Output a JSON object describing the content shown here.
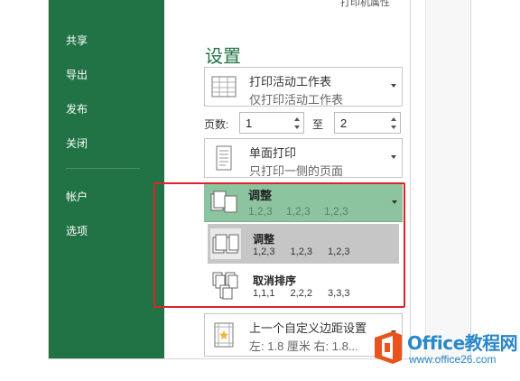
{
  "sidebar": {
    "items": [
      {
        "label": "共享"
      },
      {
        "label": "导出"
      },
      {
        "label": "发布"
      },
      {
        "label": "关闭"
      },
      {
        "label": "帐户"
      },
      {
        "label": "选项"
      }
    ]
  },
  "main": {
    "top_link": "打印机属性",
    "title": "设置",
    "print_what": {
      "title": "打印活动工作表",
      "subtitle": "仅打印活动工作表"
    },
    "pages": {
      "label": "页数:",
      "from_value": "1",
      "to_label": "至",
      "to_value": "2"
    },
    "sides": {
      "title": "单面打印",
      "subtitle": "只打印一侧的页面"
    },
    "collate": {
      "title": "调整",
      "subtitle": "1,2,3   1,2,3   1,2,3",
      "options": [
        {
          "title": "调整",
          "subtitle": "1,2,3   1,2,3   1,2,3",
          "selected": true
        },
        {
          "title": "取消排序",
          "subtitle": "1,1,1   2,2,2   3,3,3",
          "selected": false
        }
      ]
    },
    "margins": {
      "title": "上一个自定义边距设置",
      "subtitle": "左: 1.8 厘米   右: 1.8..."
    }
  },
  "watermark": {
    "brand": "Office教程网",
    "url": "www.office26.com"
  },
  "colors": {
    "sidebar": "#217346",
    "title": "#217346",
    "selected_header": "#8dc4a0",
    "highlight_border": "#d9252b",
    "watermark": "#2a87c9"
  }
}
